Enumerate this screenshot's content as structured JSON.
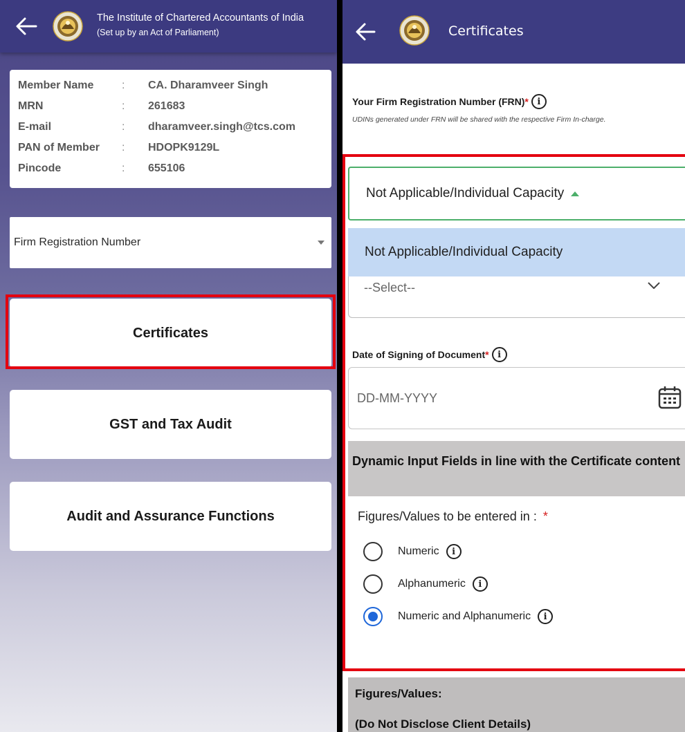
{
  "left_screen": {
    "header": {
      "title": "The Institute of Chartered Accountants of India",
      "subtitle": "(Set up by an Act of Parliament)"
    },
    "member": [
      {
        "label": "Member Name",
        "value": "CA. Dharamveer Singh"
      },
      {
        "label": "MRN",
        "value": "261683"
      },
      {
        "label": "E-mail",
        "value": "dharamveer.singh@tcs.com"
      },
      {
        "label": "PAN of Member",
        "value": "HDOPK9129L"
      },
      {
        "label": "Pincode",
        "value": "655106"
      }
    ],
    "separator": ":",
    "frn_select": "Firm Registration Number",
    "menu": [
      "Certificates",
      "GST and Tax Audit",
      "Audit and Assurance Functions"
    ]
  },
  "right_screen": {
    "header": {
      "title": "Certificates"
    },
    "frn_label": "Your Firm Registration Number (FRN)",
    "required_mark": "*",
    "frn_note": "UDINs generated under FRN will be shared with the respective Firm In-charge.",
    "frn_selected": "Not Applicable/Individual Capacity",
    "frn_option": "Not Applicable/Individual Capacity",
    "select_placeholder": "--Select--",
    "date_label": "Date of Signing of Document",
    "date_placeholder": "DD-MM-YYYY",
    "dynamic_section": "Dynamic Input Fields in line with the Certificate content",
    "figures_label": "Figures/Values to be entered in :",
    "radio_options": [
      "Numeric",
      "Alphanumeric",
      "Numeric and Alphanumeric"
    ],
    "selected_option": "Numeric and Alphanumeric",
    "figures_values_title": "Figures/Values:",
    "figures_values_note": "(Do Not Disclose Client Details)",
    "info_glyph": "i"
  },
  "colors": {
    "header": "#3c3a80",
    "highlight": "#e4000f",
    "selected_radio": "#1f67d9",
    "focus_border": "#4caf6a",
    "option_bg": "#c3d9f4"
  }
}
